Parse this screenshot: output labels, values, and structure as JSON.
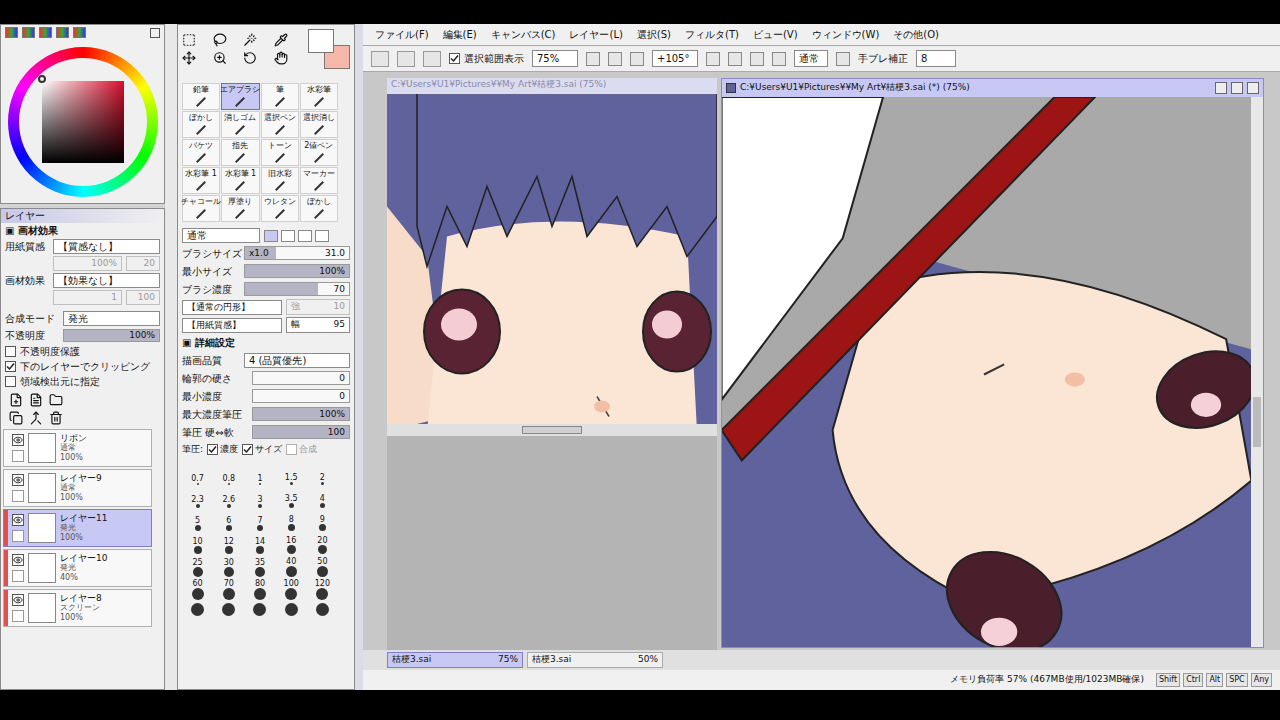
{
  "menu": [
    "ファイル(F)",
    "編集(E)",
    "キャンバス(C)",
    "レイヤー(L)",
    "選択(S)",
    "フィルタ(T)",
    "ビュー(V)",
    "ウィンドウ(W)",
    "その他(O)"
  ],
  "toolbar": {
    "selection_label": "選択範囲表示",
    "selection_checked": true,
    "zoom": "75%",
    "angle": "+105°",
    "mode": "通常",
    "stabilizer_label": "手ブレ補正",
    "stabilizer": "8"
  },
  "layer_panel": {
    "title": "レイヤー",
    "effects_header": "画材効果",
    "paper_label": "用紙質感",
    "paper_value": "【質感なし】",
    "paper_scale": "100%",
    "paper_strength": "20",
    "effect_label": "画材効果",
    "effect_value": "【効果なし】",
    "effect_width": "1",
    "effect_strength": "100",
    "blend_label": "合成モード",
    "blend_value": "発光",
    "opacity_label": "不透明度",
    "opacity": "100%",
    "opacity_level": 1,
    "checks": [
      {
        "label": "不透明度保護",
        "checked": false
      },
      {
        "label": "下のレイヤーでクリッピング",
        "checked": true
      },
      {
        "label": "領域検出元に指定",
        "checked": false
      }
    ],
    "layers": [
      {
        "name": "リボン",
        "mode": "通常",
        "opacity": "100%",
        "visible": true,
        "clipped": false,
        "selected": false
      },
      {
        "name": "レイヤー9",
        "mode": "通常",
        "opacity": "100%",
        "visible": true,
        "clipped": false,
        "selected": false
      },
      {
        "name": "レイヤー11",
        "mode": "発光",
        "opacity": "100%",
        "visible": true,
        "clipped": true,
        "selected": true
      },
      {
        "name": "レイヤー10",
        "mode": "発光",
        "opacity": "40%",
        "visible": true,
        "clipped": true,
        "selected": false
      },
      {
        "name": "レイヤー8",
        "mode": "スクリーン",
        "opacity": "100%",
        "visible": true,
        "clipped": true,
        "selected": false
      }
    ]
  },
  "tool_panel": {
    "tools": [
      {
        "label": "鉛筆",
        "selected": false
      },
      {
        "label": "エアブラシ",
        "selected": true
      },
      {
        "label": "筆",
        "selected": false
      },
      {
        "label": "水彩筆",
        "selected": false
      },
      {
        "label": "ぼかし",
        "selected": false
      },
      {
        "label": "消しゴム",
        "selected": false
      },
      {
        "label": "選択ペン",
        "selected": false
      },
      {
        "label": "選択消し",
        "selected": false
      },
      {
        "label": "バケツ",
        "selected": false
      },
      {
        "label": "指先",
        "selected": false
      },
      {
        "label": "トーン",
        "selected": false
      },
      {
        "label": "2値ペン",
        "selected": false
      },
      {
        "label": "水彩筆 1",
        "selected": false
      },
      {
        "label": "水彩筆 1",
        "selected": false
      },
      {
        "label": "旧水彩",
        "selected": false
      },
      {
        "label": "マーカー",
        "selected": false
      },
      {
        "label": "チャコール",
        "selected": false
      },
      {
        "label": "厚塗り",
        "selected": false
      },
      {
        "label": "ウレタン",
        "selected": false
      },
      {
        "label": "ぼかし",
        "selected": false
      }
    ],
    "blend": "通常",
    "fields": [
      {
        "label": "ブラシサイズ",
        "prefix": "x1.0",
        "value": "31.0",
        "level": 0.3
      },
      {
        "label": "最小サイズ",
        "prefix": "",
        "value": "100%",
        "level": 1
      },
      {
        "label": "ブラシ濃度",
        "prefix": "",
        "value": "70",
        "level": 0.7
      }
    ],
    "shape": "【通常の円形】",
    "shape_strength_label": "強",
    "shape_strength": "10",
    "texture": "【用紙質感】",
    "texture_width_label": "幅",
    "texture_width": "95",
    "detail_header": "詳細設定",
    "quality_label": "描画品質",
    "quality": "4 (品質優先)",
    "detail_fields": [
      {
        "label": "輪郭の硬さ",
        "value": "0",
        "level": 0
      },
      {
        "label": "最小濃度",
        "value": "0",
        "level": 0
      },
      {
        "label": "最大濃度筆圧",
        "value": "100%",
        "level": 1
      },
      {
        "label": "筆圧 硬⇔軟",
        "value": "100",
        "level": 1
      }
    ],
    "pressure_label": "筆圧:",
    "pressure_checks": [
      {
        "label": "濃度",
        "checked": true,
        "disabled": false
      },
      {
        "label": "サイズ",
        "checked": true,
        "disabled": false
      },
      {
        "label": "合成",
        "checked": false,
        "disabled": true
      }
    ],
    "sizes": [
      "0.7",
      "0.8",
      "1",
      "1.5",
      "2",
      "2.3",
      "2.6",
      "3",
      "3.5",
      "4",
      "5",
      "6",
      "7",
      "8",
      "9",
      "10",
      "12",
      "14",
      "16",
      "20",
      "25",
      "30",
      "35",
      "40",
      "50",
      "60",
      "70",
      "80",
      "100",
      "120"
    ]
  },
  "views": {
    "left_title": "C:¥Users¥U1¥Pictures¥¥My Art¥桔梗3.sai (75%)",
    "right_title": "C:¥Users¥U1¥Pictures¥¥My Art¥桔梗3.sai (*) (75%)"
  },
  "tabs": [
    {
      "label": "桔梗3.sai",
      "zoom": "75%",
      "selected": true
    },
    {
      "label": "桔梗3.sai",
      "zoom": "50%",
      "selected": false
    }
  ],
  "status": {
    "memory": "メモリ負荷率 57% (467MB使用/1023MB確保)",
    "keys": [
      "Shift",
      "Ctrl",
      "Alt",
      "SPC",
      "Any"
    ]
  }
}
